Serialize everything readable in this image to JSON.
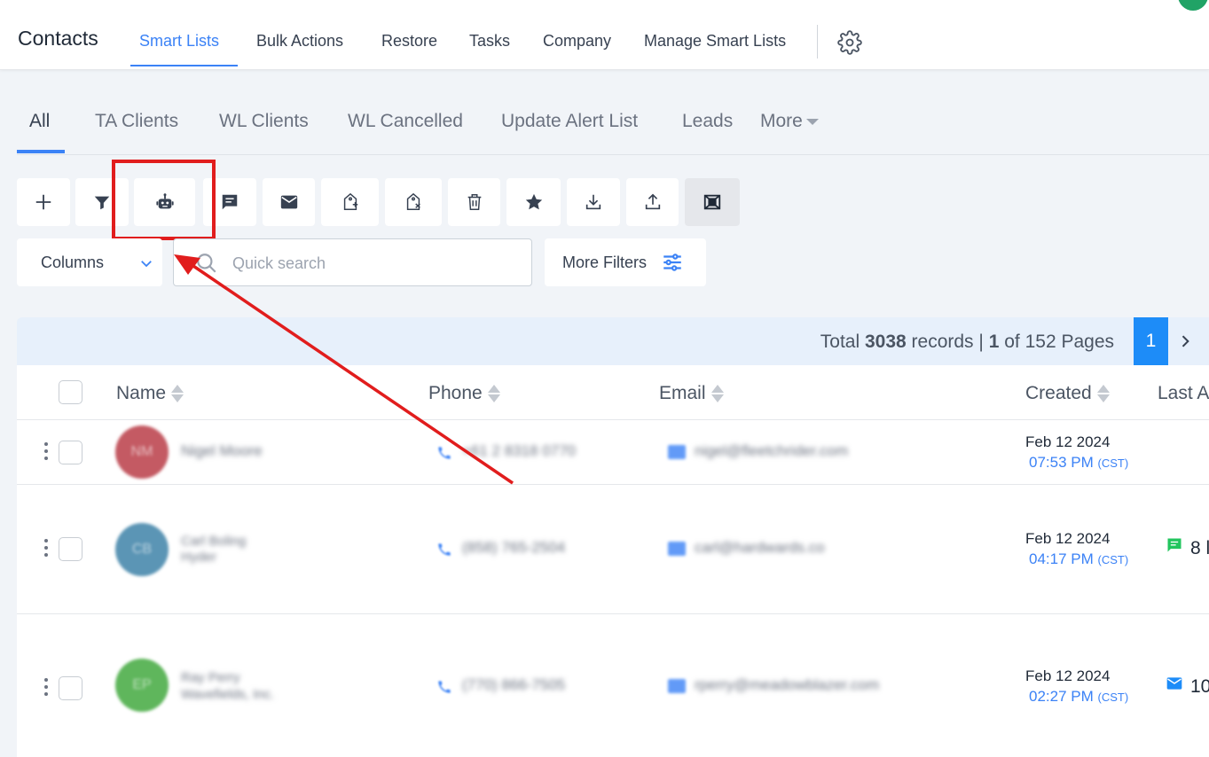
{
  "header": {
    "title": "Contacts",
    "nav": [
      {
        "label": "Smart Lists",
        "active": true
      },
      {
        "label": "Bulk Actions",
        "active": false
      },
      {
        "label": "Restore",
        "active": false
      },
      {
        "label": "Tasks",
        "active": false
      },
      {
        "label": "Company",
        "active": false
      },
      {
        "label": "Manage Smart Lists",
        "active": false
      }
    ],
    "settings_icon": "gear-icon"
  },
  "subtabs": {
    "items": [
      "All",
      "TA Clients",
      "WL Clients",
      "WL Cancelled",
      "Update Alert List",
      "Leads"
    ],
    "active": "All",
    "more_label": "More"
  },
  "toolbar": {
    "buttons": [
      {
        "icon": "plus-icon",
        "label": "Add contact"
      },
      {
        "icon": "filter-icon",
        "label": "Filter"
      },
      {
        "icon": "robot-icon",
        "label": "Add to workflow",
        "highlighted": true
      },
      {
        "icon": "message-icon",
        "label": "Send SMS"
      },
      {
        "icon": "email-icon",
        "label": "Send email"
      },
      {
        "icon": "add-tag-icon",
        "label": "Add tag"
      },
      {
        "icon": "remove-tag-icon",
        "label": "Remove tag"
      },
      {
        "icon": "trash-icon",
        "label": "Delete"
      },
      {
        "icon": "star-icon",
        "label": "Review request"
      },
      {
        "icon": "download-icon",
        "label": "Export"
      },
      {
        "icon": "upload-icon",
        "label": "Import"
      },
      {
        "icon": "merge-icon",
        "label": "Merge",
        "selected": true
      }
    ]
  },
  "filters": {
    "columns_label": "Columns",
    "search_placeholder": "Quick search",
    "search_value": "",
    "more_filters_label": "More Filters"
  },
  "pagination": {
    "total_prefix": "Total",
    "total_records": "3038",
    "records_label": "records |",
    "current_page": "1",
    "of_label": "of 152 Pages",
    "page_button": "1"
  },
  "table": {
    "columns": [
      "Name",
      "Phone",
      "Email",
      "Created",
      "Last A"
    ],
    "rows": [
      {
        "initials": "NM",
        "avatar_color": "#c45a63",
        "name": "Nigel Moore",
        "company": "",
        "phone": "+61 2 8318 0770",
        "email": "nigel@fleetchrider.com",
        "created_date": "Feb 12 2024",
        "created_time": "07:53 PM",
        "timezone": "(CST)",
        "activity_icon": "",
        "activity_count": ""
      },
      {
        "initials": "CB",
        "avatar_color": "#5b95b5",
        "name": "Carl Boling",
        "company": "Hyder",
        "phone": "(858) 765-2504",
        "email": "carl@hardwards.co",
        "created_date": "Feb 12 2024",
        "created_time": "04:17 PM",
        "timezone": "(CST)",
        "activity_icon": "chat-icon",
        "activity_count": "8 l"
      },
      {
        "initials": "EP",
        "avatar_color": "#5fb65c",
        "name": "Ray Perry",
        "company": "Wavefields, Inc.",
        "phone": "(770) 866-7505",
        "email": "rperry@meadowblazer.com",
        "created_date": "Feb 12 2024",
        "created_time": "02:27 PM",
        "timezone": "(CST)",
        "activity_icon": "email-icon",
        "activity_count": "10"
      }
    ]
  },
  "colors": {
    "accent": "#3b82f6",
    "annotation_red": "#e11d1d",
    "page_active": "#1d8cf8"
  }
}
